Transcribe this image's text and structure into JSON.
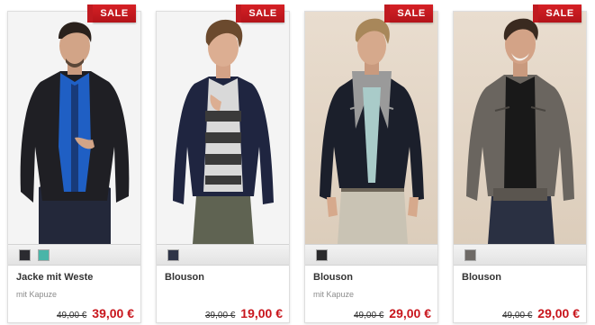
{
  "badge_label": "SALE",
  "accent_color": "#c8151c",
  "products": [
    {
      "name": "Jacke mit Weste",
      "subtitle": "mit Kapuze",
      "old_price": "49,00 €",
      "new_price": "39,00 €",
      "swatches": [
        "#2b2b30",
        "#4ab5a8"
      ],
      "image": "man in dark jacket with blue vest"
    },
    {
      "name": "Blouson",
      "subtitle": "",
      "old_price": "39,00 €",
      "new_price": "19,00 €",
      "swatches": [
        "#2e3447"
      ],
      "image": "man in navy blouson with striped shirt"
    },
    {
      "name": "Blouson",
      "subtitle": "mit Kapuze",
      "old_price": "49,00 €",
      "new_price": "29,00 €",
      "swatches": [
        "#2a2a2c"
      ],
      "image": "man in black jacket with grey hood"
    },
    {
      "name": "Blouson",
      "subtitle": "",
      "old_price": "49,00 €",
      "new_price": "29,00 €",
      "swatches": [
        "#6e6a66"
      ],
      "image": "man in grey-brown leather-look jacket"
    }
  ]
}
